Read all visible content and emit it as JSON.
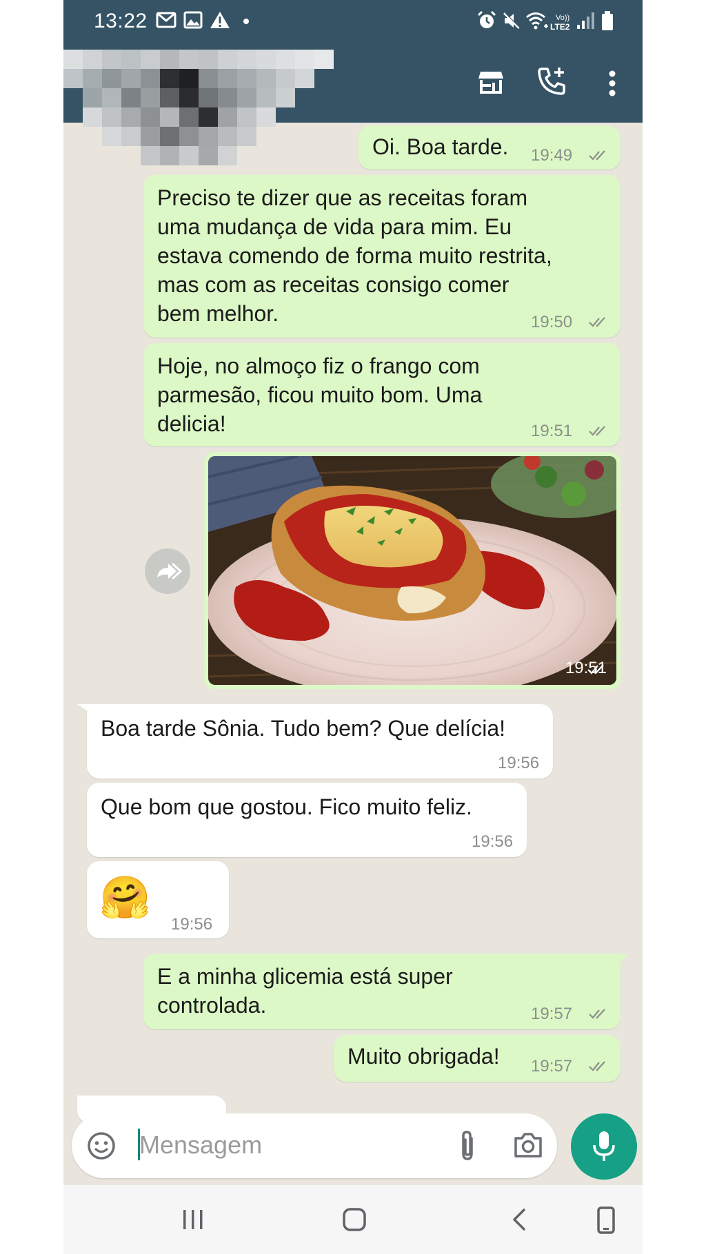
{
  "status_bar": {
    "time": "13:22",
    "icons": [
      "gmail-icon",
      "gallery-icon",
      "warning-icon",
      "dot-icon",
      "alarm-icon",
      "mute-icon",
      "wifi-calling-icon",
      "volte-lte2-icon",
      "signal-icon",
      "battery-icon"
    ]
  },
  "app_bar": {
    "icons": [
      "back-arrow-icon",
      "store-icon",
      "add-call-icon",
      "more-vert-icon"
    ],
    "contact": "pixelated"
  },
  "messages": [
    {
      "dir": "out",
      "lines": [
        "Oi. Boa tarde."
      ],
      "time": "19:49",
      "read": true
    },
    {
      "dir": "out",
      "lines": [
        "Preciso te dizer que as receitas foram",
        "uma mudança de vida para mim. Eu",
        "estava comendo de forma muito restrita,",
        "mas com as receitas consigo comer",
        "bem melhor."
      ],
      "time": "19:50",
      "read": true
    },
    {
      "dir": "out",
      "lines": [
        "Hoje, no almoço fiz o frango com",
        "parmesão, ficou muito bom. Uma",
        "delicia!"
      ],
      "time": "19:51",
      "read": true
    },
    {
      "dir": "out",
      "type": "image",
      "time": "19:51",
      "read": true,
      "image": "chicken-parmigiana-photo",
      "forward_icon": "forward-icon"
    },
    {
      "dir": "in",
      "lines": [
        "Boa tarde Sônia. Tudo bem? Que delícia!"
      ],
      "time": "19:56"
    },
    {
      "dir": "in",
      "lines": [
        "Que bom que gostou. Fico muito feliz."
      ],
      "time": "19:56"
    },
    {
      "dir": "in",
      "type": "emoji",
      "emoji": "🤗",
      "time": "19:56"
    },
    {
      "dir": "out",
      "lines": [
        "E a minha glicemia está super",
        "controlada."
      ],
      "time": "19:57",
      "read": true
    },
    {
      "dir": "out",
      "lines": [
        "Muito obrigada!"
      ],
      "time": "19:57",
      "read": true
    }
  ],
  "composer": {
    "placeholder": "Mensagem",
    "icons": [
      "emoji-icon",
      "attach-icon",
      "camera-icon",
      "mic-icon"
    ]
  },
  "nav_bar": {
    "icons": [
      "recents-icon",
      "home-icon",
      "back-icon",
      "screenshot-icon"
    ]
  },
  "colors": {
    "header": "#355364",
    "chat_background": "#e9e5dd",
    "outgoing_bubble": "#dcf8c6",
    "incoming_bubble": "#ffffff",
    "accent": "#16a085"
  }
}
